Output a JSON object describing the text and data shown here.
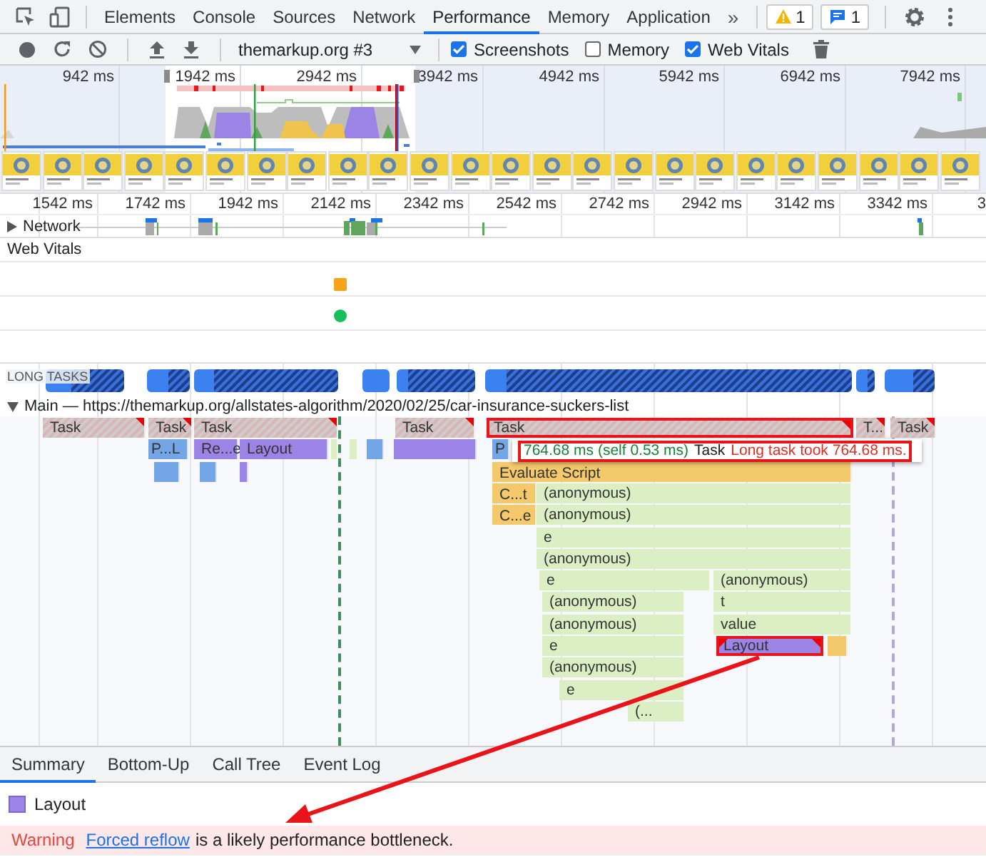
{
  "devtools_tabs": [
    {
      "label": "Elements",
      "selected": false
    },
    {
      "label": "Console",
      "selected": false
    },
    {
      "label": "Sources",
      "selected": false
    },
    {
      "label": "Network",
      "selected": false
    },
    {
      "label": "Performance",
      "selected": true
    },
    {
      "label": "Memory",
      "selected": false
    },
    {
      "label": "Application",
      "selected": false
    }
  ],
  "more_tabs": "»",
  "warnings_count": "1",
  "messages_count": "1",
  "toolbar": {
    "profile_select": "themarkup.org #3",
    "checkboxes": [
      {
        "label": "Screenshots",
        "checked": true
      },
      {
        "label": "Memory",
        "checked": false
      },
      {
        "label": "Web Vitals",
        "checked": true
      }
    ]
  },
  "overview": {
    "ticks": [
      "942 ms",
      "1942 ms",
      "2942 ms",
      "3942 ms",
      "4942 ms",
      "5942 ms",
      "6942 ms",
      "7942 ms"
    ]
  },
  "ruler": {
    "ticks": [
      "1542 ms",
      "1742 ms",
      "1942 ms",
      "2142 ms",
      "2342 ms",
      "2542 ms",
      "2742 ms",
      "2942 ms",
      "3142 ms",
      "3342 ms",
      "3"
    ]
  },
  "tracks": {
    "network": {
      "label": "Network",
      "expanded": false
    },
    "web_vitals": "Web Vitals",
    "long_tasks": "LONG TASKS",
    "main": {
      "label": "Main — https://themarkup.org/allstates-algorithm/2020/02/25/car-insurance-suckers-list",
      "expanded": true
    }
  },
  "flame_entries": [
    {
      "label": "Task",
      "kind": "task",
      "warning": true,
      "highlighted": false
    },
    {
      "label": "Task",
      "kind": "task",
      "warning": true,
      "highlighted": false
    },
    {
      "label": "Task",
      "kind": "task",
      "warning": true,
      "highlighted": false
    },
    {
      "label": "Task",
      "kind": "task",
      "warning": true,
      "highlighted": false
    },
    {
      "label": "Task",
      "kind": "task",
      "warning": true,
      "highlighted": true
    },
    {
      "label": "T...",
      "kind": "task",
      "warning": true,
      "highlighted": false
    },
    {
      "label": "Task",
      "kind": "task",
      "warning": true,
      "highlighted": false
    },
    {
      "label": "P...L",
      "kind": "parse",
      "warning": false,
      "highlighted": false
    },
    {
      "label": "Re...e",
      "kind": "render",
      "warning": false,
      "highlighted": false
    },
    {
      "label": "Layout",
      "kind": "render",
      "warning": false,
      "highlighted": false
    },
    {
      "label": "P",
      "kind": "parse",
      "warning": false,
      "highlighted": false
    },
    {
      "label": "Evaluate Script",
      "kind": "script",
      "warning": false,
      "highlighted": false
    },
    {
      "label": "C...t",
      "kind": "script",
      "warning": false,
      "highlighted": false
    },
    {
      "label": "(anonymous)",
      "kind": "function",
      "warning": false,
      "highlighted": false
    },
    {
      "label": "C...e",
      "kind": "script",
      "warning": false,
      "highlighted": false
    },
    {
      "label": "(anonymous)",
      "kind": "function",
      "warning": false,
      "highlighted": false
    },
    {
      "label": "e",
      "kind": "function",
      "warning": false,
      "highlighted": false
    },
    {
      "label": "(anonymous)",
      "kind": "function",
      "warning": false,
      "highlighted": false
    },
    {
      "label": "e",
      "kind": "function",
      "warning": false,
      "highlighted": false
    },
    {
      "label": "(anonymous)",
      "kind": "function",
      "warning": false,
      "highlighted": false
    },
    {
      "label": "(anonymous)",
      "kind": "function",
      "warning": false,
      "highlighted": false
    },
    {
      "label": "t",
      "kind": "function",
      "warning": false,
      "highlighted": false
    },
    {
      "label": "(anonymous)",
      "kind": "function",
      "warning": false,
      "highlighted": false
    },
    {
      "label": "value",
      "kind": "function",
      "warning": false,
      "highlighted": false
    },
    {
      "label": "e",
      "kind": "function",
      "warning": false,
      "highlighted": false
    },
    {
      "label": "Layout",
      "kind": "render",
      "warning": true,
      "highlighted": true
    },
    {
      "label": "(anonymous)",
      "kind": "function",
      "warning": false,
      "highlighted": false
    },
    {
      "label": "e",
      "kind": "function",
      "warning": false,
      "highlighted": false
    },
    {
      "label": "(...",
      "kind": "function",
      "warning": false,
      "highlighted": false
    }
  ],
  "tooltip": {
    "duration": "764.68 ms (self 0.53 ms)",
    "name": "Task",
    "warning": "Long task took 764.68 ms."
  },
  "details_tabs": [
    {
      "label": "Summary",
      "selected": true
    },
    {
      "label": "Bottom-Up",
      "selected": false
    },
    {
      "label": "Call Tree",
      "selected": false
    },
    {
      "label": "Event Log",
      "selected": false
    }
  ],
  "summary": {
    "title": "Layout",
    "warning_label": "Warning",
    "link": "Forced reflow",
    "message": "is a likely performance bottleneck."
  }
}
